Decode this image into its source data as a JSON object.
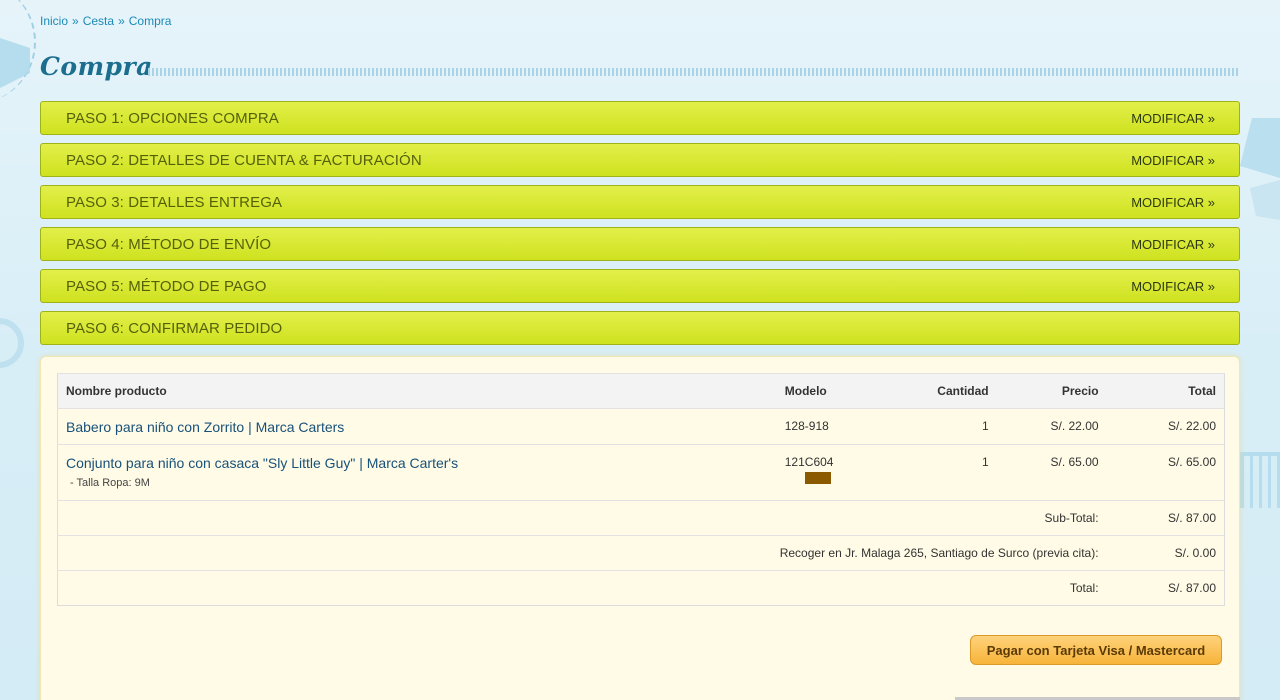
{
  "breadcrumb": {
    "home": "Inicio",
    "cart": "Cesta",
    "current": "Compra",
    "separator": "»"
  },
  "page_title": "Compra",
  "steps": [
    {
      "title": "PASO 1: OPCIONES COMPRA",
      "action": "MODIFICAR »"
    },
    {
      "title": "PASO 2: DETALLES DE CUENTA & FACTURACIÓN",
      "action": "MODIFICAR »"
    },
    {
      "title": "PASO 3: DETALLES ENTREGA",
      "action": "MODIFICAR »"
    },
    {
      "title": "PASO 4: MÉTODO DE ENVÍO",
      "action": "MODIFICAR »"
    },
    {
      "title": "PASO 5: MÉTODO DE PAGO",
      "action": "MODIFICAR »"
    },
    {
      "title": "PASO 6: CONFIRMAR PEDIDO",
      "action": ""
    }
  ],
  "cart": {
    "headers": {
      "name": "Nombre producto",
      "model": "Modelo",
      "qty": "Cantidad",
      "price": "Precio",
      "total": "Total"
    },
    "items": [
      {
        "name": "Babero para niño con Zorrito | Marca Carters",
        "option": "",
        "model": "128-918",
        "qty": "1",
        "price": "S/. 22.00",
        "total": "S/. 22.00"
      },
      {
        "name": "Conjunto para niño con casaca \"Sly Little Guy\" | Marca Carter's",
        "option": "- Talla Ropa: 9M",
        "model": "121C604",
        "qty": "1",
        "price": "S/. 65.00",
        "total": "S/. 65.00"
      }
    ],
    "totals": [
      {
        "label": "Sub-Total:",
        "value": "S/. 87.00"
      },
      {
        "label": "Recoger en Jr. Malaga 265, Santiago de Surco (previa cita):",
        "value": "S/. 0.00"
      },
      {
        "label": "Total:",
        "value": "S/. 87.00"
      }
    ]
  },
  "pay_button": "Pagar con Tarjeta Visa / Mastercard",
  "colors": {
    "step_bar": "#d6e634",
    "step_text": "#55610a",
    "link": "#18517a",
    "breadcrumb": "#1c8ab8",
    "pay_button": "#f7b43a"
  }
}
